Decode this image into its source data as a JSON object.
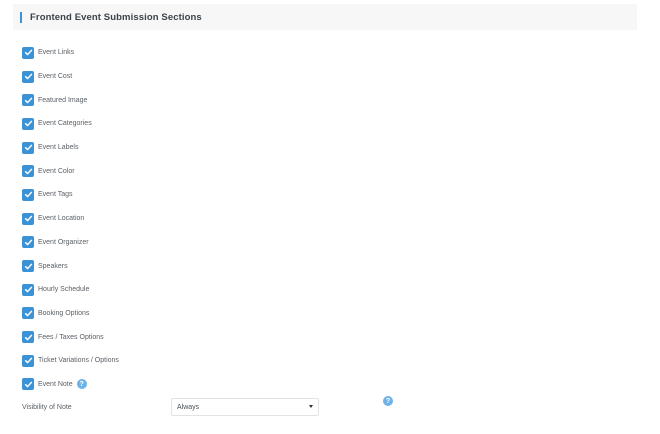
{
  "section": {
    "title": "Frontend Event Submission Sections"
  },
  "options": [
    {
      "label": "Event Links",
      "checked": true
    },
    {
      "label": "Event Cost",
      "checked": true
    },
    {
      "label": "Featured Image",
      "checked": true
    },
    {
      "label": "Event Categories",
      "checked": true
    },
    {
      "label": "Event Labels",
      "checked": true
    },
    {
      "label": "Event Color",
      "checked": true
    },
    {
      "label": "Event Tags",
      "checked": true
    },
    {
      "label": "Event Location",
      "checked": true
    },
    {
      "label": "Event Organizer",
      "checked": true
    },
    {
      "label": "Speakers",
      "checked": true
    },
    {
      "label": "Hourly Schedule",
      "checked": true
    },
    {
      "label": "Booking Options",
      "checked": true
    },
    {
      "label": "Fees / Taxes Options",
      "checked": true
    },
    {
      "label": "Ticket Variations / Options",
      "checked": true
    },
    {
      "label": "Event Note",
      "checked": true,
      "help_icon": "question-icon"
    }
  ],
  "visibility": {
    "label": "Visibility of Note",
    "selected": "Always",
    "help_icon": "question-icon"
  },
  "colors": {
    "accent": "#3b93d6",
    "help_icon": "#6fb3e6",
    "header_bg": "#f7f7f7"
  }
}
